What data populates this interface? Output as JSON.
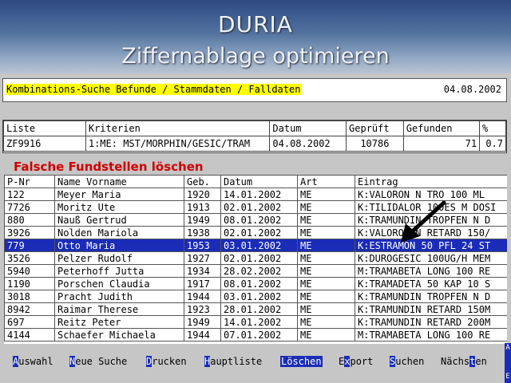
{
  "app": {
    "title": "DURIA",
    "subtitle": "Ziffernablage optimieren"
  },
  "search_bar": {
    "label": "Kombinations-Suche Befunde / Stammdaten / Falldaten",
    "date": "04.08.2002"
  },
  "criteria": {
    "headers": [
      "Liste",
      "Kriterien",
      "Datum",
      "Geprüft",
      "Gefunden",
      "%"
    ],
    "row": [
      "ZF9916",
      "1:ME: MST/MORPHIN/GESIC/TRAM",
      "04.08.2002",
      "10786",
      "71",
      "0.7"
    ]
  },
  "section_title": "Falsche Fundstellen löschen",
  "results": {
    "headers": [
      "P-Nr",
      "Name Vorname",
      "Geb.",
      "Datum",
      "Art",
      "Eintrag"
    ],
    "selected_index": 4,
    "rows": [
      [
        "122",
        "Meyer Maria",
        "1920",
        "14.01.2002",
        "ME",
        "K:VALORON N TRO 100 ML"
      ],
      [
        "7726",
        "Moritz Ute",
        "1913",
        "02.01.2002",
        "ME",
        "K:TILIDALOR 100ES M DOSI"
      ],
      [
        "880",
        "Nauß Gertrud",
        "1949",
        "08.01.2002",
        "ME",
        "K:TRAMUNDIN TROPFEN N D"
      ],
      [
        "3926",
        "Nolden Mariola",
        "1938",
        "02.01.2002",
        "ME",
        "K:VALORON N RETARD 150/"
      ],
      [
        "779",
        "Otto Maria",
        "1953",
        "03.01.2002",
        "ME",
        "K:ESTRAMON 50 PFL 24 ST"
      ],
      [
        "3526",
        "Pelzer Rudolf",
        "1927",
        "02.01.2002",
        "ME",
        "K:DUROGESIC 100UG/H MEM"
      ],
      [
        "5940",
        "Peterhoff Jutta",
        "1934",
        "28.02.2002",
        "ME",
        "M:TRAMABETA LONG 100 RE"
      ],
      [
        "1190",
        "Porschen Claudia",
        "1917",
        "08.01.2002",
        "ME",
        "K:TRAMADETA 50 KAP 10 S"
      ],
      [
        "3018",
        "Pracht Judith",
        "1944",
        "03.01.2002",
        "ME",
        "K:TRAMUNDIN TROPFEN N D"
      ],
      [
        "8942",
        "Raimar Therese",
        "1923",
        "28.01.2002",
        "ME",
        "K:TRAMUNDIN RETARD 150M"
      ],
      [
        "697",
        "Reitz Peter",
        "1949",
        "14.01.2002",
        "ME",
        "K:TRAMUNDIN RETARD 200M"
      ],
      [
        "4144",
        "Schaefer Michaela",
        "1944",
        "07.01.2002",
        "ME",
        "M:TRAMABETA LONG 100 RE"
      ]
    ]
  },
  "menu": {
    "items": [
      {
        "hotkey": "A",
        "rest": "uswahl"
      },
      {
        "hotkey": "N",
        "rest": "eue Suche"
      },
      {
        "hotkey": "D",
        "rest": "rucken"
      },
      {
        "hotkey": "H",
        "rest": "auptliste"
      },
      {
        "label": "Löschen"
      },
      {
        "pre": "E",
        "hotkey": "x",
        "rest": "port"
      },
      {
        "hotkey": "S",
        "rest": "uchen"
      },
      {
        "pre": "Nächs",
        "hotkey": "t",
        "rest": "en"
      }
    ]
  },
  "scrollbar": {
    "top_letter": "A",
    "bottom_letter": "E"
  },
  "colors": {
    "selection": "#1a2cb8",
    "highlight": "#ffff00",
    "section_title": "#d00000"
  }
}
